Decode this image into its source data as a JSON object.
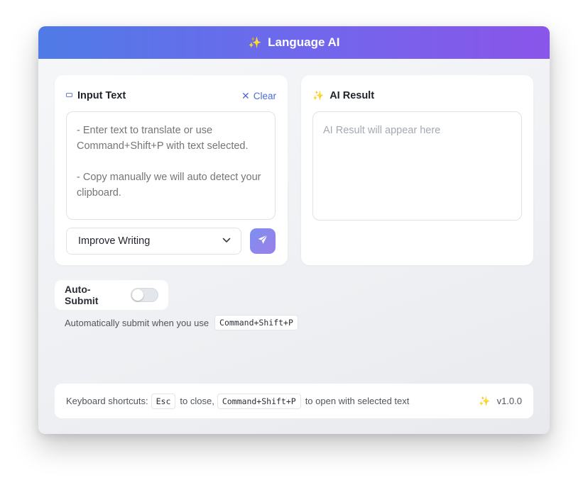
{
  "window": {
    "title": "Language AI",
    "title_icon": "sparkles-icon"
  },
  "input_panel": {
    "title": "Input Text",
    "icon": "keyboard-icon",
    "clear_label": "Clear",
    "placeholder": "- Enter text to translate or use Command+Shift+P with text selected.\n\n- Copy manually we will auto detect your clipboard.",
    "value": "",
    "mode_selected": "Improve Writing",
    "send_icon": "paper-plane-icon"
  },
  "result_panel": {
    "title": "AI Result",
    "icon": "sparkles-icon",
    "placeholder": "AI Result will appear here"
  },
  "auto_submit": {
    "label": "Auto-Submit",
    "enabled": false,
    "description": "Automatically submit when you use",
    "shortcut": "Command+Shift+P"
  },
  "footer": {
    "prefix": "Keyboard shortcuts:",
    "close_key": "Esc",
    "close_text": "to close,",
    "open_key": "Command+Shift+P",
    "open_text": "to open with selected text",
    "version": "v1.0.0"
  },
  "colors": {
    "title_gradient_start": "#4f7be6",
    "title_gradient_end": "#8a55ea",
    "accent": "#4d6ad8"
  }
}
